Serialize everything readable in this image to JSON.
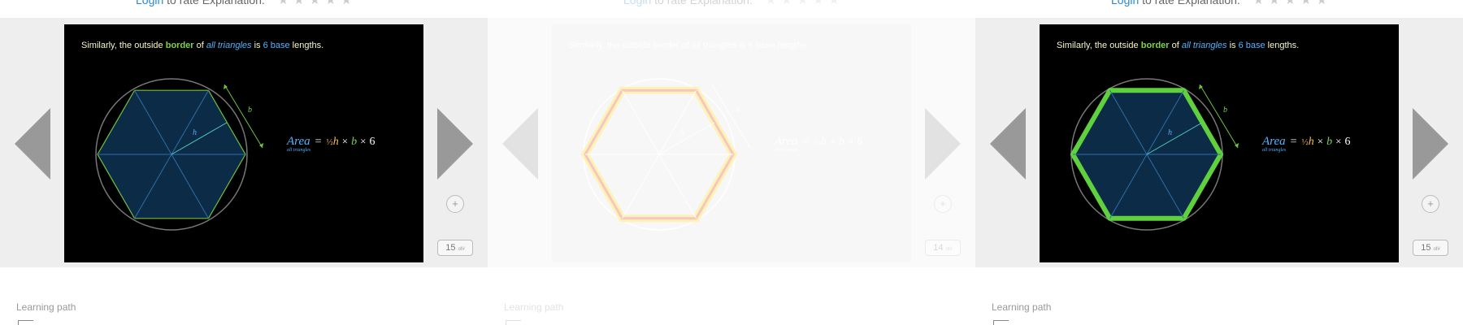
{
  "top": {
    "login_label": "Login",
    "rate_text": "to rate Explanation.",
    "stars": "★★★★★"
  },
  "slide": {
    "text_1": "Similarly, the outside ",
    "text_border": "border",
    "text_2": " of ",
    "text_all_triangles": "all triangles",
    "text_3": " is ",
    "text_six_base": "6 base",
    "text_4": " lengths.",
    "label_h": "h",
    "label_b": "b",
    "formula": {
      "area": "Area",
      "area_sub": "all triangles",
      "eq": "=",
      "frac": "½",
      "h": "h",
      "times": "×",
      "b": "b",
      "six": "6"
    }
  },
  "panels": [
    {
      "counter": "15",
      "counter_suffix": "of#"
    },
    {
      "counter": "14",
      "counter_suffix": "of#"
    },
    {
      "counter": "15",
      "counter_suffix": "of#"
    }
  ],
  "zoom_icon": "+",
  "learning_path_label": "Learning path",
  "colors": {
    "accent_green": "#7ad44a",
    "accent_blue": "#4fb4ff",
    "highlight_red": "#e8331c",
    "highlight_yellow": "#f5d800"
  }
}
